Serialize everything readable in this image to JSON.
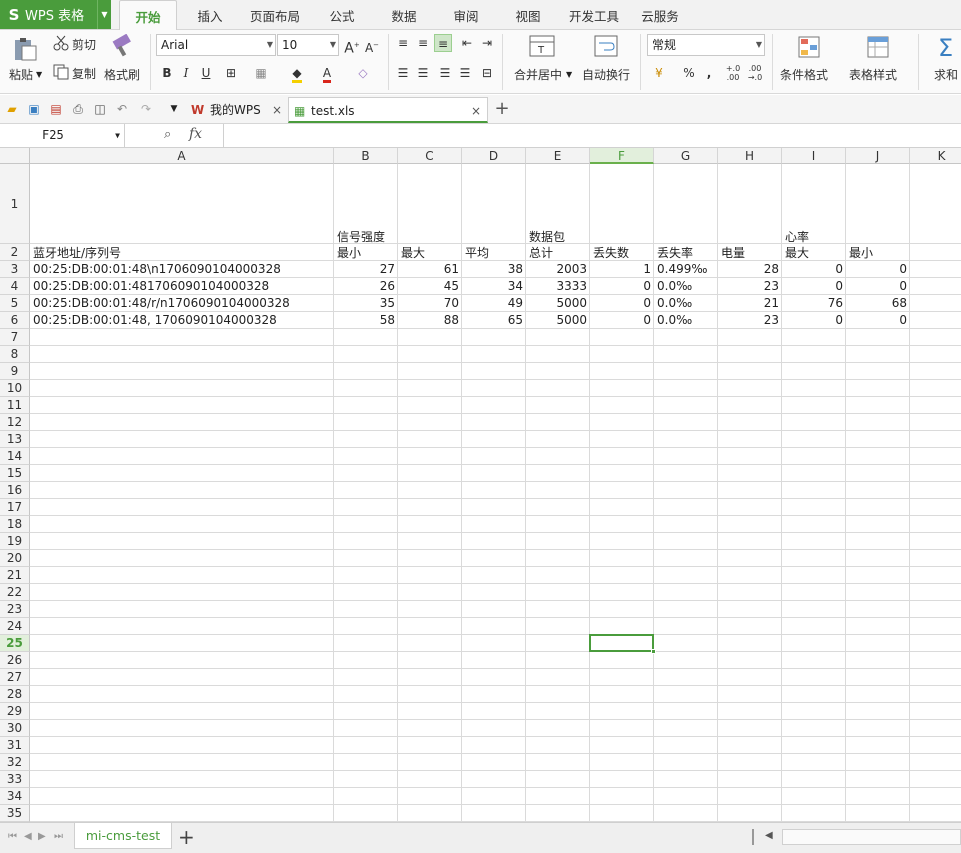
{
  "app": {
    "logo": "S",
    "name": "WPS 表格"
  },
  "menu_tabs": [
    "开始",
    "插入",
    "页面布局",
    "公式",
    "数据",
    "审阅",
    "视图",
    "开发工具",
    "云服务"
  ],
  "ribbon": {
    "paste": "粘贴",
    "cut": "剪切",
    "copy": "复制",
    "format_painter": "格式刷",
    "font_name": "Arial",
    "font_size": "10",
    "bold": "B",
    "italic": "I",
    "underline": "U",
    "merge_center": "合并居中",
    "wrap_text": "自动换行",
    "number_format": "常规",
    "percent": "%",
    "comma": ",",
    "conditional_format": "条件格式",
    "table_style": "表格样式",
    "sum": "求和",
    "accent": "#4a9c3c"
  },
  "doc_tabs": [
    {
      "label": "我的WPS"
    },
    {
      "label": "test.xls"
    }
  ],
  "formula_bar": {
    "name_box": "F25",
    "fx": "fx",
    "content": ""
  },
  "columns": [
    "A",
    "B",
    "C",
    "D",
    "E",
    "F",
    "G",
    "H",
    "I",
    "J",
    "K"
  ],
  "rows": [
    "1",
    "2",
    "3",
    "4",
    "5",
    "6",
    "7",
    "8",
    "9",
    "10",
    "11",
    "12",
    "13",
    "14",
    "15",
    "16",
    "17",
    "18",
    "19",
    "20",
    "21",
    "22",
    "23",
    "24",
    "25",
    "26",
    "27",
    "28",
    "29",
    "30",
    "31",
    "32",
    "33",
    "34",
    "35"
  ],
  "header_row1": {
    "B": "信号强度",
    "E": "数据包",
    "I": "心率"
  },
  "header_row2": {
    "A": "蓝牙地址/序列号",
    "B": "最小",
    "C": "最大",
    "D": "平均",
    "E": "总计",
    "F": "丢失数",
    "G": "丢失率",
    "H": "电量",
    "I": "最大",
    "J": "最小"
  },
  "data_rows": [
    {
      "A": "00:25:DB:00:01:48\\n1706090104000328",
      "B": "27",
      "C": "61",
      "D": "38",
      "E": "2003",
      "F": "1",
      "G": "0.499‰",
      "H": "28",
      "I": "0",
      "J": "0"
    },
    {
      "A": "00:25:DB:00:01:481706090104000328",
      "B": "26",
      "C": "45",
      "D": "34",
      "E": "3333",
      "F": "0",
      "G": "0.0‰",
      "H": "23",
      "I": "0",
      "J": "0"
    },
    {
      "A": "00:25:DB:00:01:48/r/n1706090104000328",
      "B": "35",
      "C": "70",
      "D": "49",
      "E": "5000",
      "F": "0",
      "G": "0.0‰",
      "H": "21",
      "I": "76",
      "J": "68"
    },
    {
      "A": "00:25:DB:00:01:48, 1706090104000328",
      "B": "58",
      "C": "88",
      "D": "65",
      "E": "5000",
      "F": "0",
      "G": "0.0‰",
      "H": "23",
      "I": "0",
      "J": "0"
    }
  ],
  "active_cell": {
    "column": "F",
    "row": "25"
  },
  "sheets": [
    {
      "label": "mi-cms-test"
    }
  ]
}
